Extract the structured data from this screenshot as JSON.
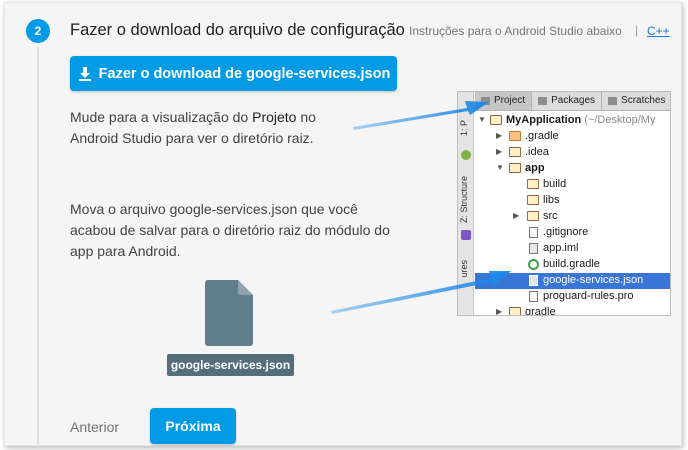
{
  "step": {
    "number": "2",
    "title": "Fazer o download do arquivo de configuração",
    "hint": "Instruções para o Android Studio abaixo",
    "separator": "|",
    "alt_link": "C++"
  },
  "download_button": {
    "label": "Fazer o download de google-services.json",
    "icon": "download-icon"
  },
  "instructions": {
    "p1_line1_before": "Mude para a visualização do ",
    "p1_bold": "Projeto",
    "p1_line1_after": " no",
    "p1_line2": "Android Studio para ver o diretório raiz.",
    "p2_line1": "Mova o arquivo google-services.json que você",
    "p2_line2": "acabou de salvar para o diretório raiz do módulo do",
    "p2_line3": "app para Android."
  },
  "file": {
    "name": "google-services.json",
    "icon": "file-icon"
  },
  "nav": {
    "previous": "Anterior",
    "next": "Próxima"
  },
  "android_studio": {
    "tabs": [
      "Project",
      "Packages",
      "Scratches"
    ],
    "side_tabs": [
      "1: P",
      "Z: Structure",
      "ures"
    ],
    "tree": [
      {
        "arrow": "▼",
        "icon": "project-icon",
        "label": "MyApplication",
        "sub": " (~/Desktop/My",
        "bold": true
      },
      {
        "arrow": "▶",
        "icon": "folder-orange-icon",
        "label": ".gradle"
      },
      {
        "arrow": "▶",
        "icon": "folder-icon",
        "label": ".idea"
      },
      {
        "arrow": "▼",
        "icon": "module-folder-icon",
        "label": "app",
        "bold": true
      },
      {
        "arrow": "",
        "icon": "folder-icon",
        "label": "build"
      },
      {
        "arrow": "",
        "icon": "folder-icon",
        "label": "libs"
      },
      {
        "arrow": "▶",
        "icon": "folder-icon",
        "label": "src"
      },
      {
        "arrow": "",
        "icon": "file-icon",
        "label": ".gitignore"
      },
      {
        "arrow": "",
        "icon": "iml-file-icon",
        "label": "app.iml"
      },
      {
        "arrow": "",
        "icon": "gradle-icon",
        "label": "build.gradle"
      },
      {
        "arrow": "",
        "icon": "json-file-icon",
        "label": "google-services.json",
        "selected": true
      },
      {
        "arrow": "",
        "icon": "file-icon",
        "label": "proguard-rules.pro"
      },
      {
        "arrow": "▶",
        "icon": "folder-icon",
        "label": "gradle"
      }
    ]
  },
  "colors": {
    "accent": "#039be5",
    "selection": "#3875d7",
    "arrow": "#1e88e5",
    "chip": "#546e7a"
  }
}
